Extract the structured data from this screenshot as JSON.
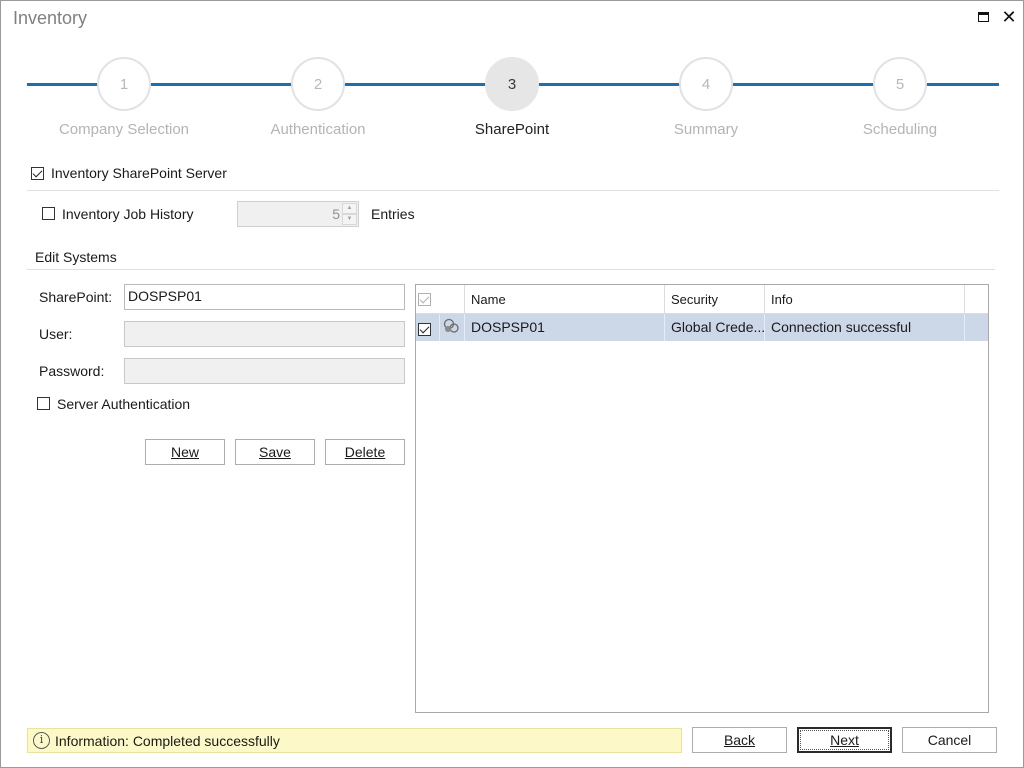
{
  "window": {
    "title": "Inventory"
  },
  "steps": [
    {
      "number": "1",
      "label": "Company Selection"
    },
    {
      "number": "2",
      "label": "Authentication"
    },
    {
      "number": "3",
      "label": "SharePoint"
    },
    {
      "number": "4",
      "label": "Summary"
    },
    {
      "number": "5",
      "label": "Scheduling"
    }
  ],
  "active_step": 3,
  "inventory_sharepoint": {
    "label": "Inventory SharePoint Server",
    "checked": true
  },
  "job_history": {
    "label": "Inventory Job History",
    "checked": false,
    "value": "5",
    "suffix": "Entries"
  },
  "edit_systems": {
    "title": "Edit Systems",
    "sharepoint_label": "SharePoint:",
    "sharepoint_value": "DOSPSP01",
    "user_label": "User:",
    "user_value": "",
    "password_label": "Password:",
    "password_value": "",
    "server_auth": {
      "label": "Server Authentication",
      "checked": false
    },
    "buttons": {
      "new": "New",
      "save": "Save",
      "delete": "Delete"
    }
  },
  "grid": {
    "columns": [
      "Name",
      "Security",
      "Info"
    ],
    "rows": [
      {
        "checked": true,
        "icon": "sharepoint-server-icon",
        "name": "DOSPSP01",
        "security": "Global Crede...",
        "info": "Connection successful"
      }
    ]
  },
  "status": {
    "text": "Information: Completed successfully"
  },
  "footer": {
    "back": "Back",
    "next": "Next",
    "cancel": "Cancel"
  },
  "colors": {
    "accent": "#1e6fb0",
    "row_selected": "#ccd8e8",
    "status_bg": "#fdf8c8"
  }
}
